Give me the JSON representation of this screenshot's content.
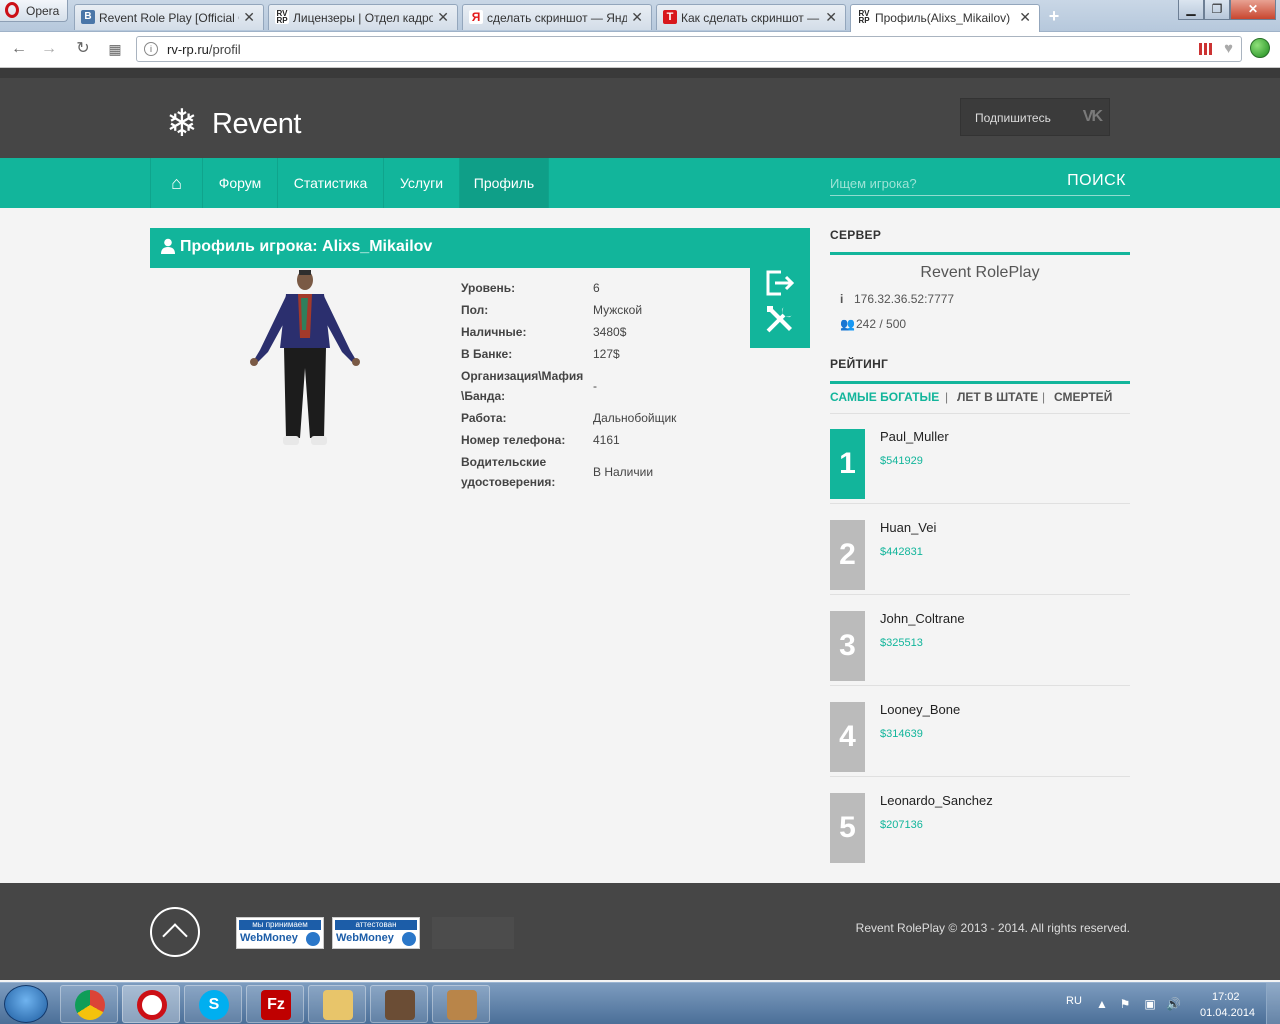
{
  "browser": {
    "menu_label": "Opera",
    "tabs": [
      {
        "title": "Revent Role Play [Official G",
        "favicon": "vk-icon"
      },
      {
        "title": "Лицензеры | Отдел кадров",
        "favicon": "rvrp-icon"
      },
      {
        "title": "сделать скриншот — Янд",
        "favicon": "yandex-icon"
      },
      {
        "title": "Как сделать скриншот —",
        "favicon": "red-t-icon"
      },
      {
        "title": "Профиль(Alixs_Mikailov)",
        "favicon": "rvrp-icon"
      }
    ],
    "active_tab": 4,
    "url_domain": "rv-rp.ru",
    "url_path": "/profil"
  },
  "site": {
    "logo_text": "Revent",
    "subscribe_label": "Подпишитесь",
    "vk_logo": "VK",
    "nav": [
      "Форум",
      "Статистика",
      "Услуги",
      "Профиль"
    ],
    "nav_active": "Профиль",
    "search_placeholder": "Ищем игрока?",
    "search_button": "ПОИСК"
  },
  "profile": {
    "title": "Профиль игрока: Alixs_Mikailov",
    "stats": [
      {
        "label": "Уровень:",
        "value": "6"
      },
      {
        "label": "Пол:",
        "value": "Мужской"
      },
      {
        "label": "Наличные:",
        "value": "3480$"
      },
      {
        "label": "В Банке:",
        "value": "127$"
      },
      {
        "label": "Организация\\Мафия \\Банда:",
        "value": "-"
      },
      {
        "label": "Работа:",
        "value": "Дальнобойщик"
      },
      {
        "label": "Номер телефона:",
        "value": "4161"
      },
      {
        "label": "Водительские удостоверения:",
        "value": "В Наличии"
      }
    ]
  },
  "sidebar": {
    "server_heading": "СЕРВЕР",
    "server_name": "Revent RolePlay",
    "server_ip": "176.32.36.52:7777",
    "players_online": "242",
    "players_max": "500",
    "rating_heading": "РЕЙТИНГ",
    "rating_tabs": [
      "САМЫЕ БОГАТЫЕ",
      "ЛЕТ В ШТАТЕ",
      "СМЕРТЕЙ"
    ],
    "rating_tab_selected": "САМЫЕ БОГАТЫЕ",
    "ranking": [
      {
        "rank": "1",
        "name": "Paul_Muller",
        "money": "$541929"
      },
      {
        "rank": "2",
        "name": "Huan_Vei",
        "money": "$442831"
      },
      {
        "rank": "3",
        "name": "John_Coltrane",
        "money": "$325513"
      },
      {
        "rank": "4",
        "name": "Looney_Bone",
        "money": "$314639"
      },
      {
        "rank": "5",
        "name": "Leonardo_Sanchez",
        "money": "$207136"
      }
    ]
  },
  "footer": {
    "webmoney_1_top": "мы принимаем",
    "webmoney_2_top": "аттестован",
    "webmoney_brand": "WebMoney",
    "copyright": "Revent RolePlay © 2013 - 2014. All rights reserved."
  },
  "taskbar": {
    "lang": "RU",
    "time": "17:02",
    "date": "01.04.2014"
  },
  "colors": {
    "accent": "#12b59b",
    "header_bg": "#464646",
    "rank_inactive": "#bbbbbb"
  }
}
